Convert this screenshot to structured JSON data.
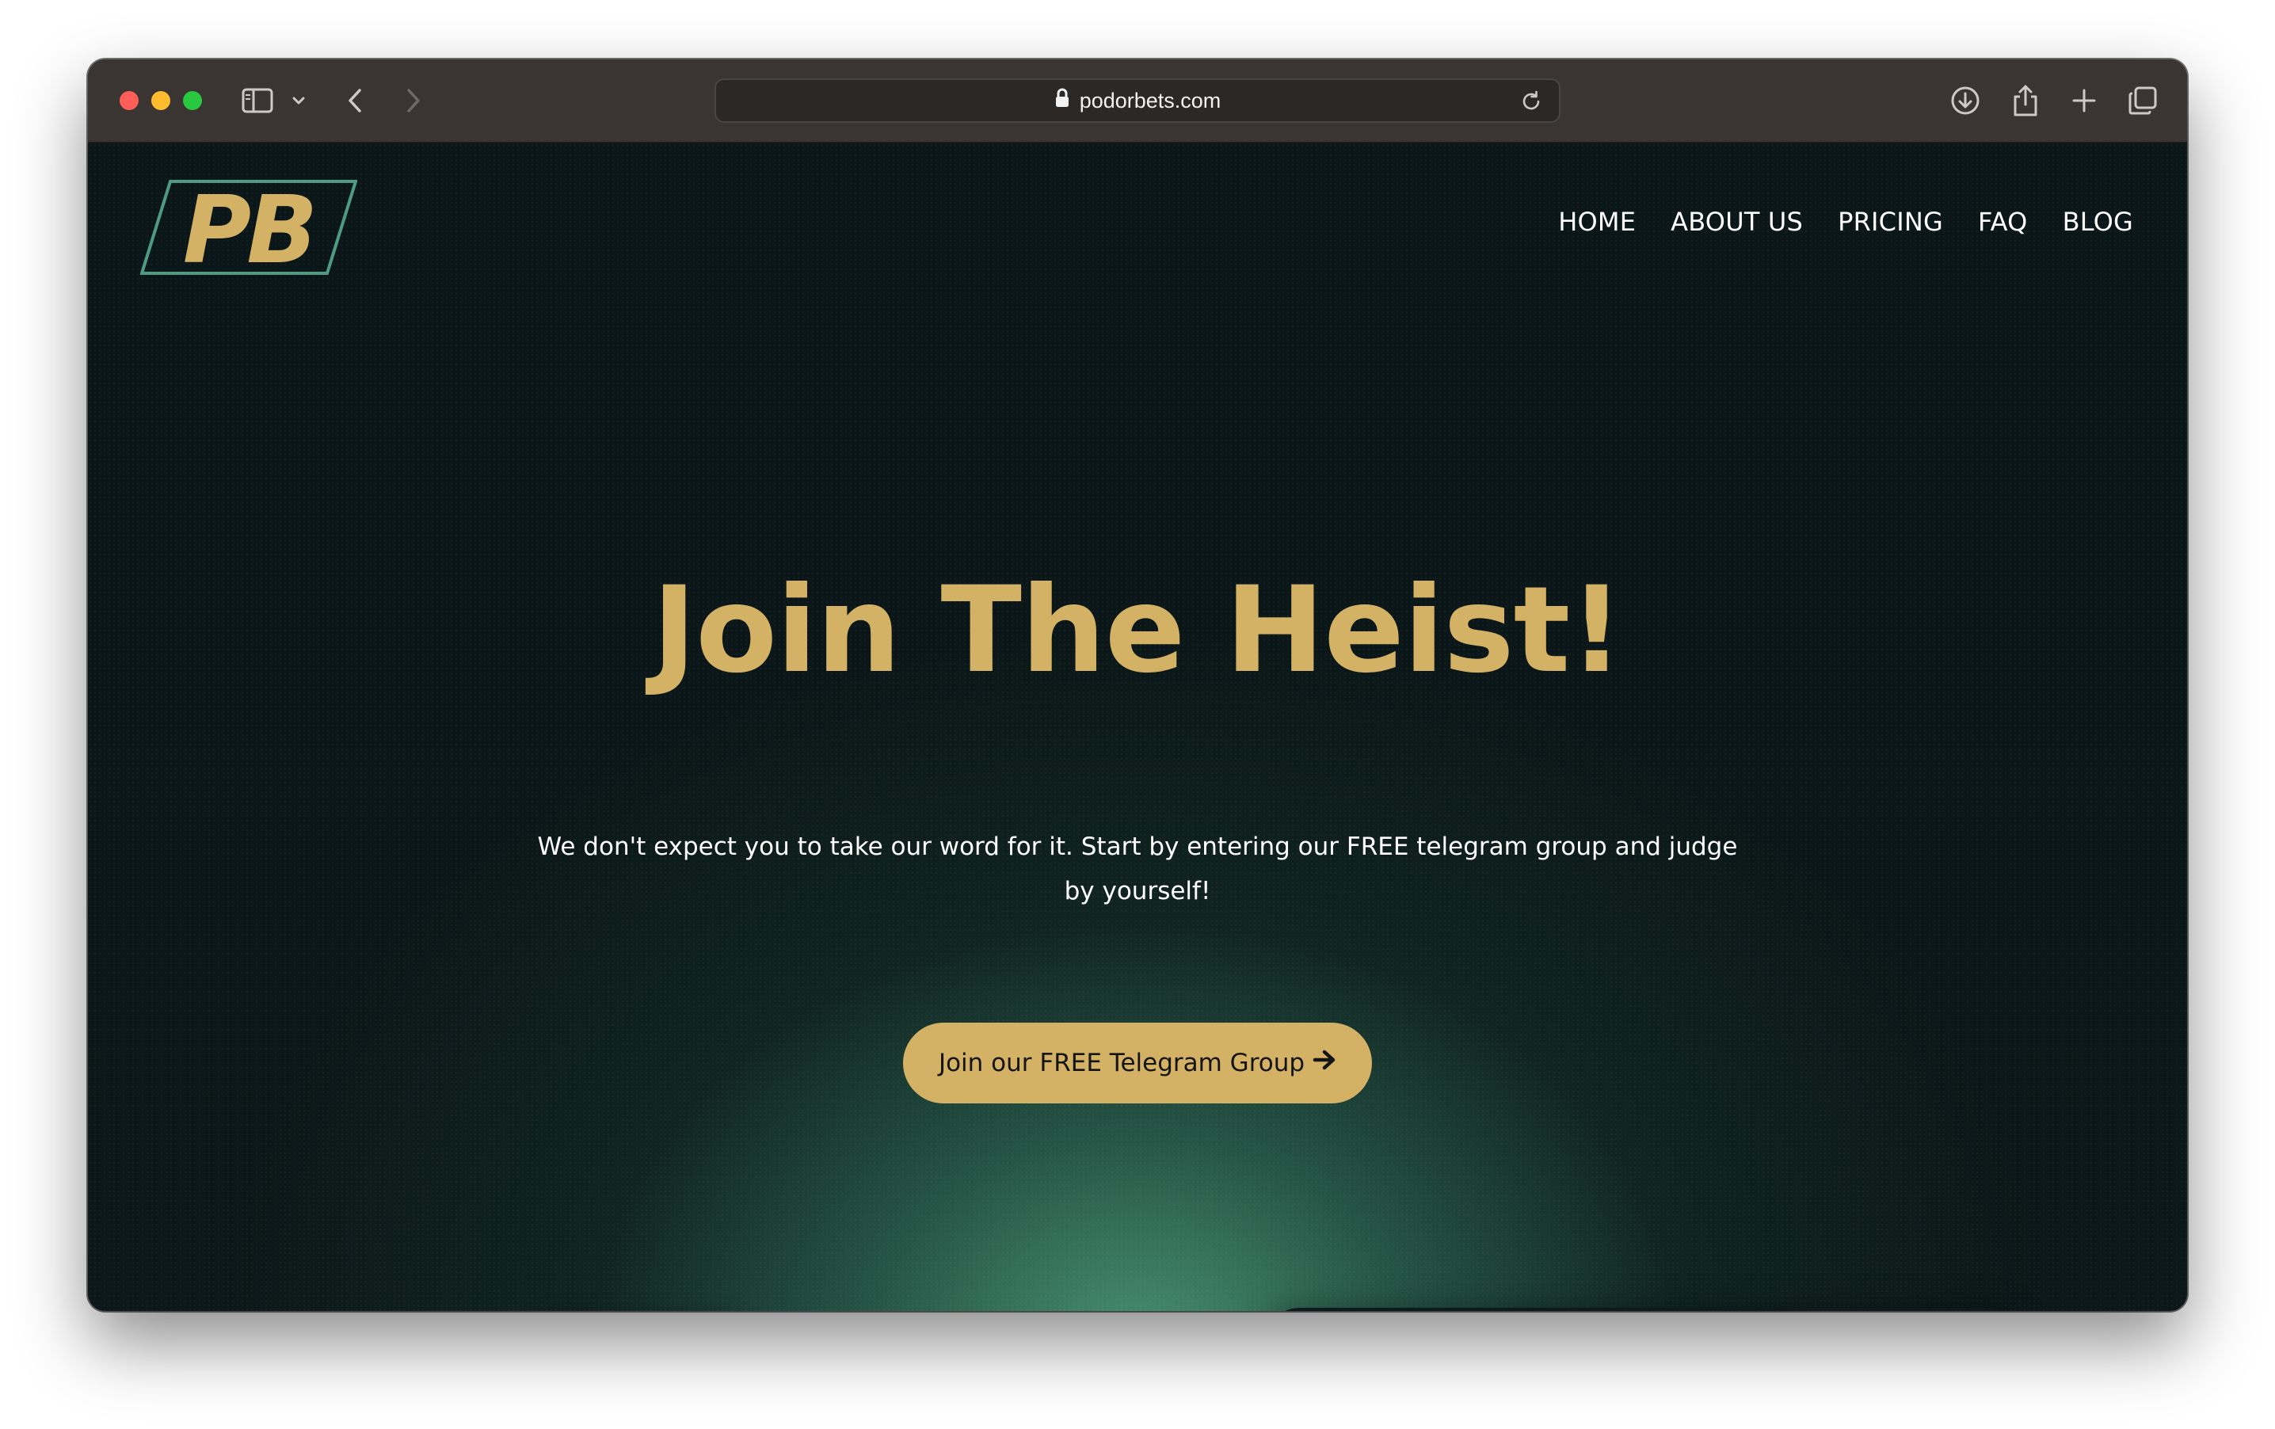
{
  "browser": {
    "url": "podorbets.com",
    "icons": {
      "sidebar": "sidebar-icon",
      "sidebar_menu": "chevron-down-icon",
      "back": "chevron-left-icon",
      "forward": "chevron-right-icon",
      "lock": "lock-icon",
      "reload": "reload-icon",
      "downloads": "download-icon",
      "share": "share-icon",
      "new_tab": "plus-icon",
      "tab_overview": "tabs-icon"
    }
  },
  "site": {
    "logo_text": "PB",
    "nav": [
      {
        "label": "HOME"
      },
      {
        "label": "ABOUT US"
      },
      {
        "label": "PRICING"
      },
      {
        "label": "FAQ"
      },
      {
        "label": "BLOG"
      }
    ],
    "hero": {
      "title": "Join The Heist!",
      "subtitle": "We don't expect you to take our word for it. Start by entering our FREE telegram group and judge by yourself!",
      "cta_label": "Join our FREE Telegram Group"
    },
    "colors": {
      "gold": "#d4b265",
      "background": "#0b1616",
      "glow": "#4a9676",
      "logo_outline": "#4f9a82"
    }
  }
}
